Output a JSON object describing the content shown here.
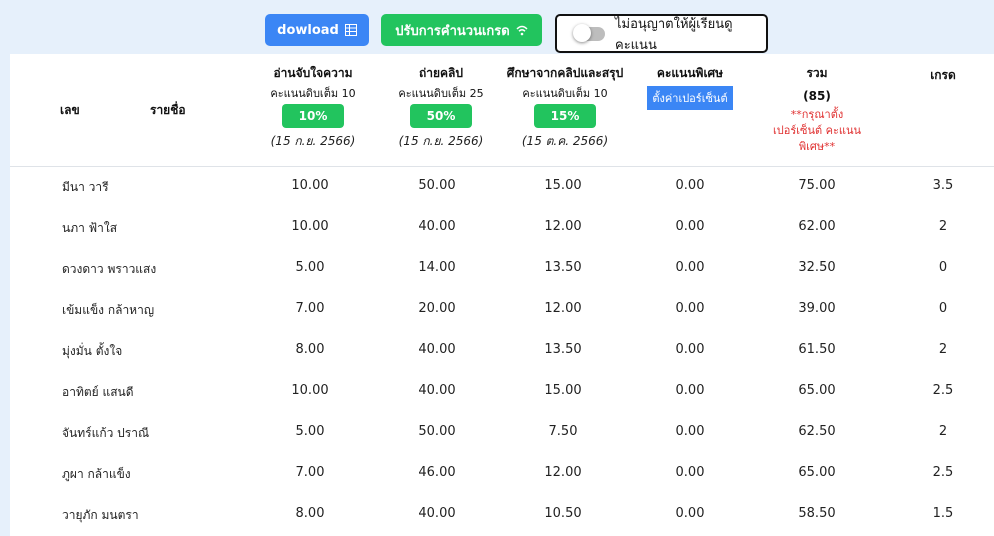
{
  "toolbar": {
    "download_label": "dowload",
    "grade_label": "ปรับการคำนวนเกรด",
    "toggle_label": "ไม่อนุญาตให้ผู้เรียนดูคะแนน"
  },
  "header": {
    "col_no": "เลข",
    "col_name": "รายชื่อ",
    "assignments": [
      {
        "title": "อ่านจับใจความ",
        "max": "คะแนนดิบเต็ม 10",
        "percent": "10%",
        "date": "(15 ก.ย. 2566)"
      },
      {
        "title": "ถ่ายคลิป",
        "max": "คะแนนดิบเต็ม 25",
        "percent": "50%",
        "date": "(15 ก.ย. 2566)"
      },
      {
        "title": "ศึกษาจากคลิปและสรุป",
        "max": "คะแนนดิบเต็ม 10",
        "percent": "15%",
        "date": "(15 ต.ค. 2566)"
      }
    ],
    "special": {
      "title": "คะแนนพิเศษ",
      "button": "ตั้งค่าเปอร์เซ็นต์"
    },
    "total": {
      "title": "รวม",
      "sub": "(85)",
      "note1": "**กรุณาตั้ง",
      "note2": "เปอร์เซ็นต์ คะแนน",
      "note3": "พิเศษ**"
    },
    "grade": "เกรด"
  },
  "rows": [
    {
      "name": "มีนา วารี",
      "s1": "10.00",
      "s2": "50.00",
      "s3": "15.00",
      "sp": "0.00",
      "total": "75.00",
      "grade": "3.5"
    },
    {
      "name": "นภา ฟ้าใส",
      "s1": "10.00",
      "s2": "40.00",
      "s3": "12.00",
      "sp": "0.00",
      "total": "62.00",
      "grade": "2"
    },
    {
      "name": "ดวงดาว พราวแสง",
      "s1": "5.00",
      "s2": "14.00",
      "s3": "13.50",
      "sp": "0.00",
      "total": "32.50",
      "grade": "0"
    },
    {
      "name": "เข้มแข็ง กล้าหาญ",
      "s1": "7.00",
      "s2": "20.00",
      "s3": "12.00",
      "sp": "0.00",
      "total": "39.00",
      "grade": "0"
    },
    {
      "name": "มุ่งมั่น ตั้งใจ",
      "s1": "8.00",
      "s2": "40.00",
      "s3": "13.50",
      "sp": "0.00",
      "total": "61.50",
      "grade": "2"
    },
    {
      "name": "อาทิตย์ แสนดี",
      "s1": "10.00",
      "s2": "40.00",
      "s3": "15.00",
      "sp": "0.00",
      "total": "65.00",
      "grade": "2.5"
    },
    {
      "name": "จันทร์แก้ว ปราณี",
      "s1": "5.00",
      "s2": "50.00",
      "s3": "7.50",
      "sp": "0.00",
      "total": "62.50",
      "grade": "2"
    },
    {
      "name": "ภูผา กล้าแข็ง",
      "s1": "7.00",
      "s2": "46.00",
      "s3": "12.00",
      "sp": "0.00",
      "total": "65.00",
      "grade": "2.5"
    },
    {
      "name": "วายุภัก มนตรา",
      "s1": "8.00",
      "s2": "40.00",
      "s3": "10.50",
      "sp": "0.00",
      "total": "58.50",
      "grade": "1.5"
    }
  ]
}
